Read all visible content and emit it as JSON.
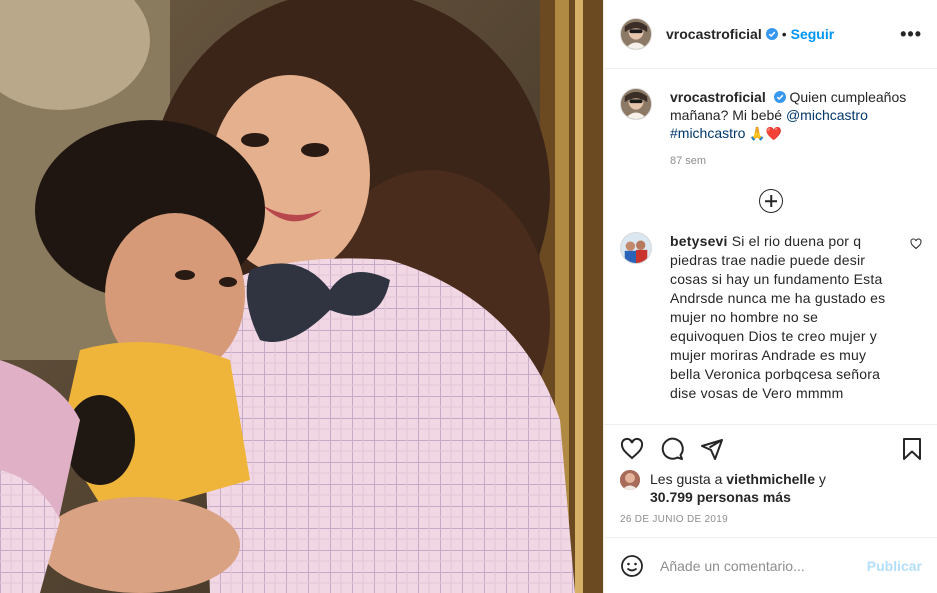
{
  "post": {
    "username": "vrocastroficial",
    "follow_label": "Seguir",
    "dot": "•",
    "more_label": "•••",
    "verified_icon": "verified-badge-icon",
    "accent": "#0095f6"
  },
  "caption": {
    "username": "vrocastroficial",
    "text_1": "Quien cumpleaños mañana? Mi bebé",
    "mention": "@michcastro",
    "hashtag": "#michcastro",
    "emojis": "🙏❤️",
    "time": "87 sem"
  },
  "comment": {
    "username": "betysevi",
    "text": "Si el rio duena por q piedras trae nadie puede desir cosas si hay un fundamento Esta Andrsde nunca me ha gustado es mujer no hombre no se equivoquen Dios te creo mujer y mujer moriras Andrade es muy bella Veronica porbqcesa señora dise vosas de Vero mmmm"
  },
  "likes": {
    "prefix": "Les gusta a",
    "user": "viethmichelle",
    "joiner": "y",
    "count": "30.799 personas más"
  },
  "date": "26 DE JUNIO DE 2019",
  "add_comment": {
    "placeholder": "Añade un comentario...",
    "publish_label": "Publicar"
  }
}
